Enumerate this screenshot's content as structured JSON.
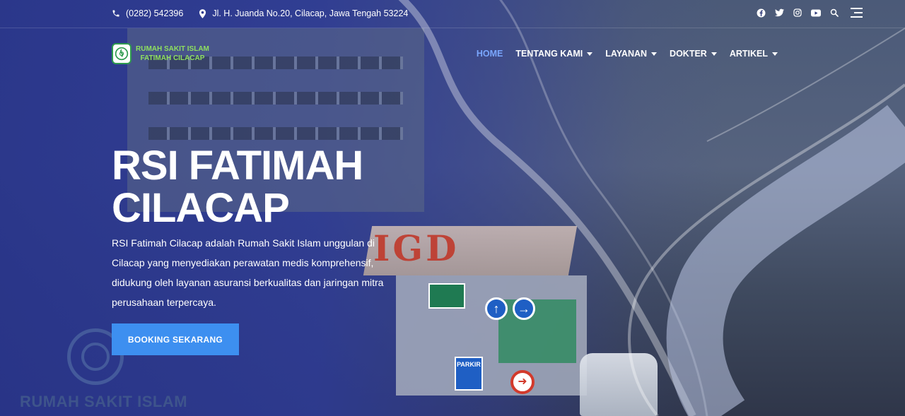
{
  "topbar": {
    "phone": "(0282) 542396",
    "address": "Jl. H. Juanda No.20, Cilacap, Jawa Tengah 53224",
    "social": [
      "facebook-icon",
      "twitter-icon",
      "instagram-icon",
      "youtube-icon"
    ]
  },
  "brand": {
    "line1": "RUMAH SAKIT ISLAM",
    "line2": "FATIMAH CILACAP"
  },
  "nav": {
    "items": [
      {
        "label": "HOME",
        "active": true,
        "dropdown": false
      },
      {
        "label": "TENTANG KAMI",
        "active": false,
        "dropdown": true
      },
      {
        "label": "LAYANAN",
        "active": false,
        "dropdown": true
      },
      {
        "label": "DOKTER",
        "active": false,
        "dropdown": true
      },
      {
        "label": "ARTIKEL",
        "active": false,
        "dropdown": true
      }
    ]
  },
  "hero": {
    "title_line1": "RSI FATIMAH",
    "title_line2": "CILACAP",
    "description": "RSI Fatimah Cilacap adalah Rumah Sakit Islam unggulan di Cilacap yang menyediakan perawatan medis komprehensif, didukung oleh layanan asuransi berkualitas dan jaringan mitra perusahaan terpercaya.",
    "cta_label": "BOOKING SEKARANG"
  },
  "background": {
    "igd_sign": "IGD",
    "parkir_sign": "PARKIR",
    "building_text": "RUMAH SAKIT ISLAM"
  },
  "colors": {
    "accent": "#3d8ff0",
    "active_nav": "#7aa7ff",
    "logo_text": "#8fe05f"
  }
}
